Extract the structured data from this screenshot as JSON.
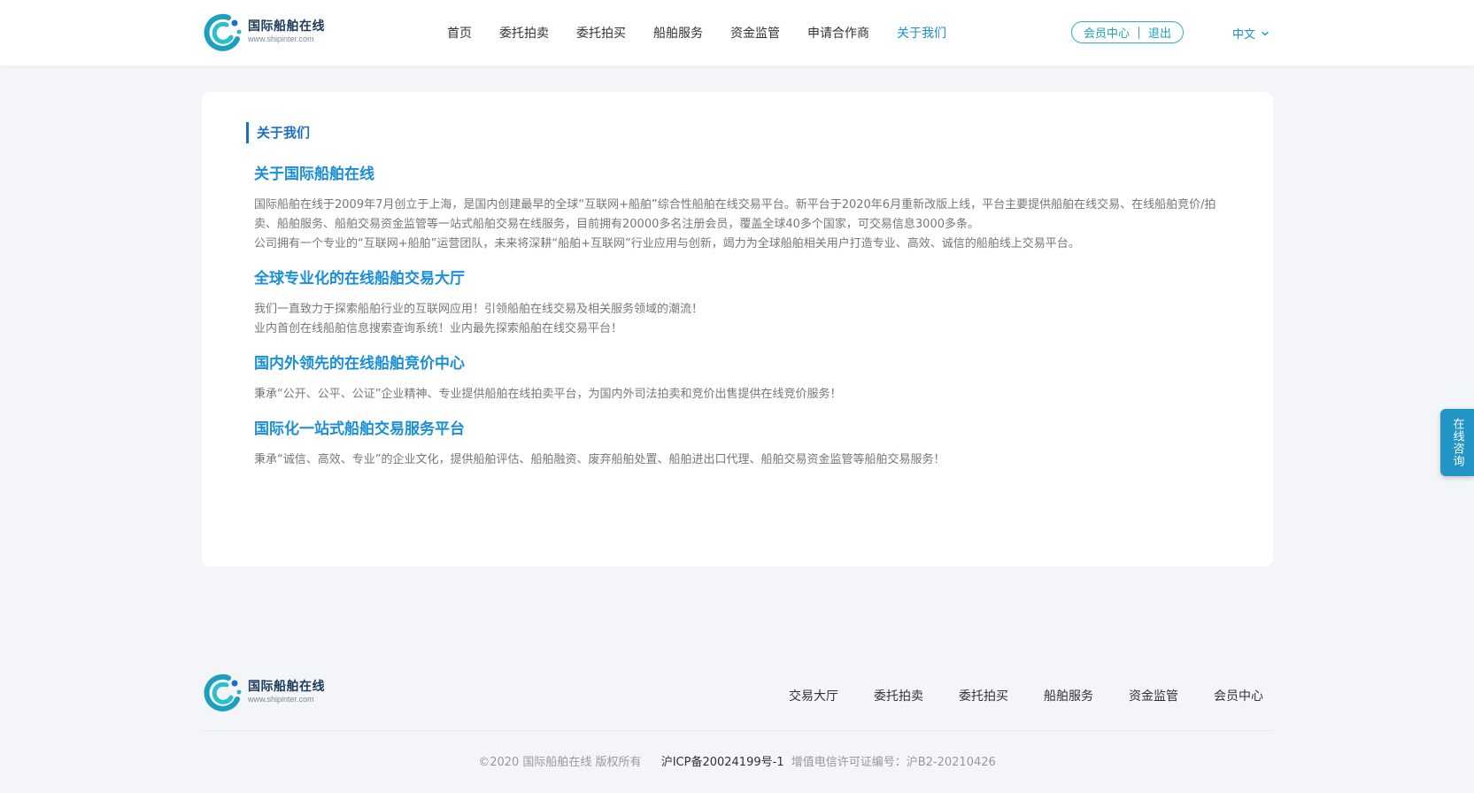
{
  "header": {
    "logo": {
      "name": "国际船舶在线",
      "url": "www.shipinter.com"
    },
    "nav": [
      {
        "label": "首页",
        "active": false
      },
      {
        "label": "委托拍卖",
        "active": false
      },
      {
        "label": "委托拍买",
        "active": false
      },
      {
        "label": "船舶服务",
        "active": false
      },
      {
        "label": "资金监管",
        "active": false
      },
      {
        "label": "申请合作商",
        "active": false
      },
      {
        "label": "关于我们",
        "active": true
      }
    ],
    "member_center": "会员中心",
    "logout": "退出",
    "language": "中文"
  },
  "main": {
    "section_title": "关于我们",
    "blocks": [
      {
        "heading": "关于国际船舶在线",
        "paragraphs": [
          "国际船舶在线于2009年7月创立于上海，是国内创建最早的全球“互联网+船舶”综合性船舶在线交易平台。新平台于2020年6月重新改版上线，平台主要提供船舶在线交易、在线船舶竞价/拍卖、船舶服务、船舶交易资金监管等一站式船舶交易在线服务，目前拥有20000多名注册会员，覆盖全球40多个国家，可交易信息3000多条。",
          "公司拥有一个专业的“互联网+船舶”运营团队，未来将深耕“船舶+互联网”行业应用与创新，竭力为全球船舶相关用户打造专业、高效、诚信的船舶线上交易平台。"
        ]
      },
      {
        "heading": "全球专业化的在线船舶交易大厅",
        "paragraphs": [
          "我们一直致力于探索船舶行业的互联网应用！引领船舶在线交易及相关服务领域的潮流！",
          "业内首创在线船舶信息搜索查询系统！业内最先探索船舶在线交易平台！"
        ]
      },
      {
        "heading": "国内外领先的在线船舶竞价中心",
        "paragraphs": [
          "秉承“公开、公平、公证”企业精神、专业提供船舶在线拍卖平台，为国内外司法拍卖和竞价出售提供在线竞价服务！"
        ]
      },
      {
        "heading": "国际化一站式船舶交易服务平台",
        "paragraphs": [
          "秉承“诚信、高效、专业”的企业文化，提供船舶评估、船舶融资、废弃船舶处置、船舶进出口代理、船舶交易资金监管等船舶交易服务！"
        ]
      }
    ]
  },
  "float_consult": "在线咨询",
  "footer": {
    "logo": {
      "name": "国际船舶在线",
      "url": "www.shipinter.com"
    },
    "nav": [
      "交易大厅",
      "委托拍卖",
      "委托拍买",
      "船舶服务",
      "资金监管",
      "会员中心"
    ],
    "copyright": "©2020 国际船舶在线 版权所有",
    "icp": "沪ICP备20024199号-1",
    "license": "增值电信许可证编号：沪B2-20210426"
  },
  "colors": {
    "primary": "#1a8fd6",
    "accent_teal": "#2bb3c0",
    "page_bg": "#f3f5f8"
  },
  "icons": [
    "logo-mark-icon",
    "chevron-down-icon"
  ]
}
